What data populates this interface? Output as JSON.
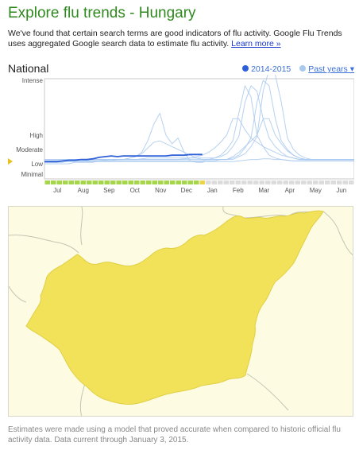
{
  "page": {
    "title": "Explore flu trends - Hungary",
    "intro_text": "We've found that certain search terms are good indicators of flu activity. Google Flu Trends uses aggregated Google search data to estimate flu activity.",
    "learn_more": "Learn more »"
  },
  "chart_header": {
    "title": "National",
    "current_season": "2014-2015",
    "past_years": "Past years ▾"
  },
  "colors": {
    "title_green": "#2f8a1e",
    "current_line": "#2d5fd8",
    "past_lines": "#a9c9ef",
    "map_fill": "#f2e25a",
    "map_background": "#fdfce2"
  },
  "chart_data": {
    "type": "line",
    "y_levels": [
      "Minimal",
      "Low",
      "Moderate",
      "High",
      "Intense"
    ],
    "x_months": [
      "Jul",
      "Aug",
      "Sep",
      "Oct",
      "Nov",
      "Dec",
      "Jan",
      "Feb",
      "Mar",
      "Apr",
      "May",
      "Jun"
    ],
    "current_level_marker": "Low",
    "series": [
      {
        "name": "2014-2015",
        "current": true,
        "values": [
          1.15,
          1.15,
          1.15,
          1.2,
          1.25,
          1.25,
          1.3,
          1.3,
          1.35,
          1.45,
          1.5,
          1.55,
          1.5,
          1.55,
          1.55,
          1.55,
          1.55,
          1.55,
          1.55,
          1.55,
          1.55,
          1.6,
          1.6,
          1.6,
          1.65,
          1.65,
          1.65
        ]
      },
      {
        "current": false,
        "values": [
          1.0,
          1.0,
          1.0,
          1.0,
          1.0,
          1.1,
          1.1,
          1.1,
          1.1,
          1.2,
          1.2,
          1.2,
          1.3,
          1.3,
          1.4,
          1.5,
          1.8,
          2.6,
          3.2,
          3.4,
          3.0,
          2.4,
          2.8,
          1.8,
          1.2,
          1.1,
          1.1,
          1.2,
          1.2,
          1.3,
          1.3,
          1.3,
          1.5,
          1.7,
          2.2,
          2.9,
          3.8,
          4.2,
          4.1,
          3.6,
          2.8,
          2.0,
          1.6,
          1.4,
          1.3,
          1.3,
          1.3,
          1.3,
          1.3,
          1.3,
          1.3,
          1.3
        ]
      },
      {
        "current": false,
        "values": [
          1.1,
          1.1,
          1.1,
          1.1,
          1.2,
          1.2,
          1.2,
          1.2,
          1.2,
          1.2,
          1.25,
          1.3,
          1.3,
          1.3,
          1.4,
          1.5,
          1.7,
          2.1,
          2.5,
          2.6,
          2.4,
          2.2,
          2.0,
          1.8,
          1.6,
          1.4,
          1.3,
          1.3,
          1.3,
          1.3,
          1.3,
          1.4,
          1.6,
          2.1,
          2.8,
          3.6,
          4.0,
          3.9,
          3.3,
          2.6,
          2.0,
          1.6,
          1.4,
          1.3,
          1.3,
          1.3,
          1.3,
          1.3,
          1.3,
          1.3,
          1.3,
          1.3
        ]
      },
      {
        "current": false,
        "values": [
          1.2,
          1.2,
          1.2,
          1.2,
          1.2,
          1.2,
          1.2,
          1.25,
          1.3,
          1.3,
          1.3,
          1.3,
          1.3,
          1.3,
          1.3,
          1.3,
          1.35,
          1.4,
          1.4,
          1.4,
          1.4,
          1.4,
          1.4,
          1.4,
          1.4,
          1.4,
          1.4,
          1.4,
          1.4,
          1.5,
          1.7,
          2.2,
          2.9,
          3.6,
          3.9,
          3.8,
          3.3,
          2.8,
          2.2,
          1.8,
          1.5,
          1.4,
          1.3,
          1.3,
          1.3,
          1.3,
          1.3,
          1.3,
          1.3,
          1.3,
          1.3,
          1.3
        ]
      },
      {
        "current": false,
        "values": [
          1.3,
          1.3,
          1.3,
          1.3,
          1.3,
          1.3,
          1.3,
          1.3,
          1.3,
          1.3,
          1.3,
          1.3,
          1.3,
          1.3,
          1.3,
          1.3,
          1.3,
          1.3,
          1.3,
          1.3,
          1.3,
          1.3,
          1.3,
          1.3,
          1.3,
          1.3,
          1.3,
          1.3,
          1.3,
          1.3,
          1.3,
          1.5,
          1.8,
          2.2,
          2.6,
          3.0,
          3.3,
          3.3,
          3.0,
          2.4,
          1.9,
          1.6,
          1.4,
          1.3,
          1.3,
          1.3,
          1.3,
          1.3,
          1.3,
          1.3,
          1.3,
          1.3
        ]
      },
      {
        "current": false,
        "values": [
          1.3,
          1.3,
          1.3,
          1.3,
          1.3,
          1.3,
          1.3,
          1.3,
          1.3,
          1.3,
          1.3,
          1.3,
          1.3,
          1.3,
          1.3,
          1.3,
          1.3,
          1.3,
          1.3,
          1.3,
          1.3,
          1.3,
          1.3,
          1.35,
          1.4,
          1.5,
          1.6,
          1.8,
          2.1,
          2.5,
          3.0,
          3.3,
          3.3,
          3.1,
          2.8,
          2.5,
          2.2,
          2.0,
          1.8,
          1.6,
          1.5,
          1.4,
          1.3,
          1.3,
          1.3,
          1.3,
          1.3,
          1.3,
          1.3,
          1.3,
          1.3,
          1.3
        ]
      },
      {
        "current": false,
        "values": [
          1.2,
          1.2,
          1.2,
          1.2,
          1.2,
          1.2,
          1.2,
          1.2,
          1.2,
          1.2,
          1.2,
          1.2,
          1.2,
          1.2,
          1.2,
          1.2,
          1.2,
          1.2,
          1.2,
          1.2,
          1.2,
          1.2,
          1.2,
          1.2,
          1.2,
          1.2,
          1.2,
          1.3,
          1.4,
          1.6,
          2.0,
          2.6,
          3.4,
          3.9,
          3.7,
          3.0,
          2.2,
          1.6,
          1.4,
          1.3,
          1.25,
          1.2,
          1.2,
          1.2,
          1.2,
          1.2,
          1.2,
          1.2,
          1.2,
          1.2,
          1.2,
          1.2
        ]
      },
      {
        "current": false,
        "values": [
          1.15,
          1.15,
          1.15,
          1.15,
          1.15,
          1.15,
          1.15,
          1.15,
          1.15,
          1.15,
          1.15,
          1.15,
          1.15,
          1.15,
          1.15,
          1.15,
          1.15,
          1.15,
          1.15,
          1.15,
          1.15,
          1.15,
          1.15,
          1.15,
          1.15,
          1.15,
          1.15,
          1.15,
          1.15,
          1.15,
          1.15,
          1.15,
          1.2,
          1.25,
          1.3,
          1.3,
          1.35,
          1.35,
          1.3,
          1.3,
          1.25,
          1.2,
          1.2,
          1.2,
          1.2,
          1.2,
          1.2,
          1.2,
          1.2,
          1.2,
          1.2,
          1.2
        ]
      }
    ]
  },
  "footer": {
    "text": "Estimates were made using a model that proved accurate when compared to historic official flu activity data. Data current through January 3, 2015."
  }
}
